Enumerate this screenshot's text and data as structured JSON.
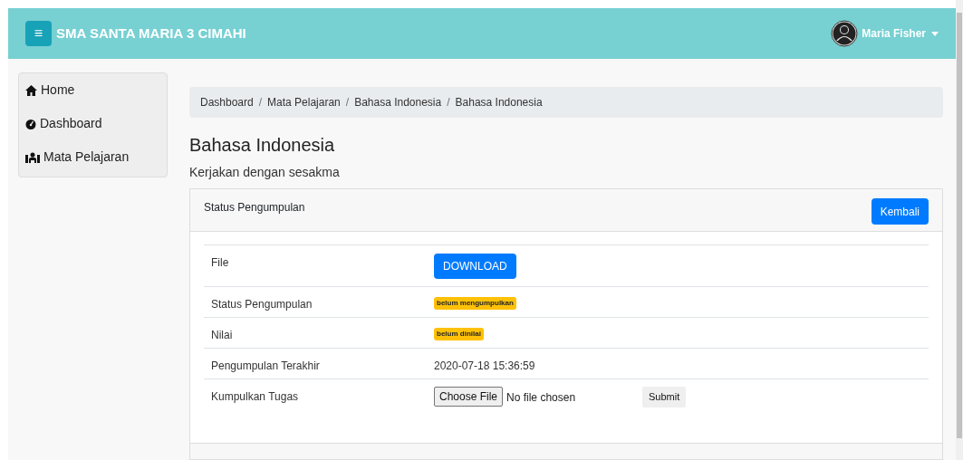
{
  "navbar": {
    "menu_icon": "≡",
    "brand": "SMA SANTA MARIA 3 CIMAHI",
    "user": "Maria Fisher"
  },
  "sidebar": {
    "items": [
      {
        "label": "Home"
      },
      {
        "label": "Dashboard"
      },
      {
        "label": "Mata Pelajaran"
      }
    ]
  },
  "breadcrumb": {
    "separator": "/",
    "items": [
      "Dashboard",
      "Mata Pelajaran",
      "Bahasa Indonesia",
      "Bahasa Indonesia"
    ]
  },
  "title": "Bahasa Indonesia",
  "subtitle": "Kerjakan dengan sesakma",
  "card": {
    "title": "Status Pengumpulan",
    "back_button": "Kembali",
    "rows": [
      {
        "label": "File",
        "kind": "button",
        "value": "DOWNLOAD"
      },
      {
        "label": "Status Pengumpulan",
        "kind": "badge",
        "value": "belum mengumpulkan"
      },
      {
        "label": "Nilai",
        "kind": "badge",
        "value": "belum dinilai"
      },
      {
        "label": "Pengumpulan Terakhir",
        "kind": "text",
        "value": "2020-07-18 15:36:59"
      },
      {
        "label": "Kumpulkan Tugas",
        "kind": "upload",
        "file_button": "Choose File",
        "file_status": "No file chosen",
        "submit": "Submit"
      }
    ]
  }
}
